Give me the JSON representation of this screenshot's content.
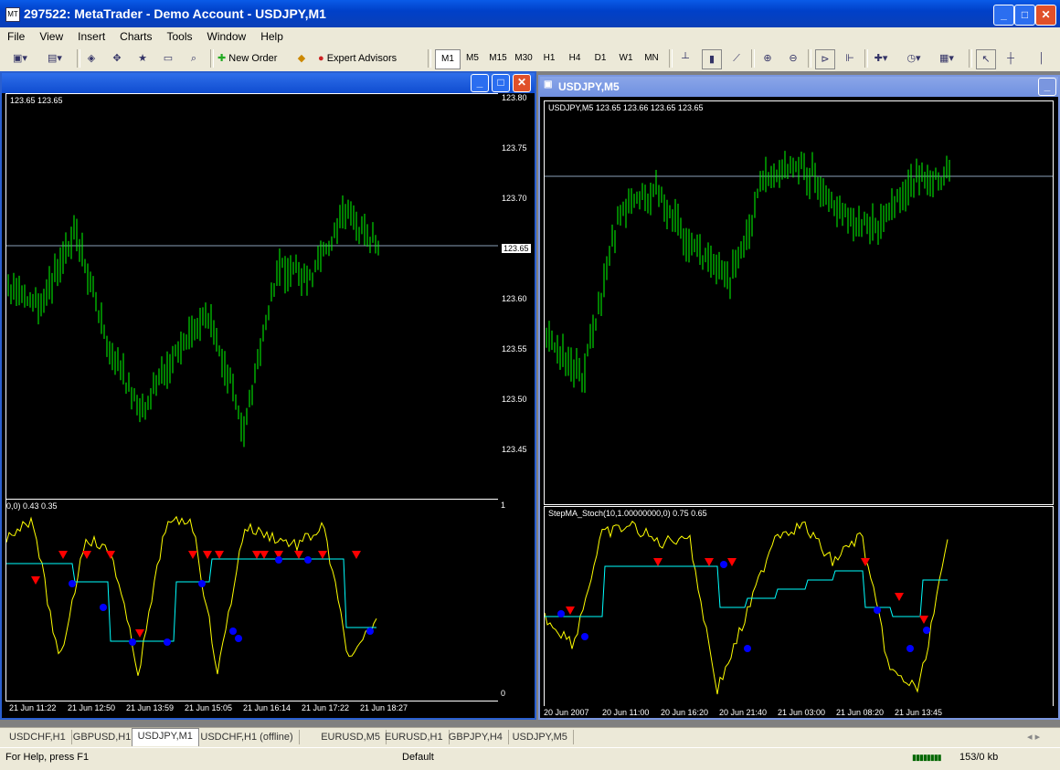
{
  "app": {
    "title": "297522: MetaTrader - Demo Account - USDJPY,M1"
  },
  "menu": [
    "File",
    "View",
    "Insert",
    "Charts",
    "Tools",
    "Window",
    "Help"
  ],
  "toolbar": {
    "new_order": "New Order",
    "expert_advisors": "Expert Advisors",
    "timeframes": [
      "M1",
      "M5",
      "M15",
      "M30",
      "H1",
      "H4",
      "D1",
      "W1",
      "MN"
    ]
  },
  "left_window": {
    "ohlc": "123.65 123.65",
    "price_labels": [
      "123.80",
      "123.75",
      "123.70",
      "123.65",
      "123.60",
      "123.55",
      "123.50",
      "123.45"
    ],
    "current_price": "123.65",
    "indicator_header": "0,0) 0.43 0.35",
    "indicator_scale": [
      "1",
      "0"
    ],
    "time_labels": [
      "21 Jun 11:22",
      "21 Jun 12:50",
      "21 Jun 13:59",
      "21 Jun 15:05",
      "21 Jun 16:14",
      "21 Jun 17:22",
      "21 Jun 18:27"
    ]
  },
  "right_window": {
    "title": "USDJPY,M5",
    "ohlc": "USDJPY,M5  123.65 123.66 123.65 123.65",
    "indicator_header": "StepMA_Stoch(10,1.00000000,0) 0.75 0.65",
    "time_labels": [
      "20 Jun 2007",
      "20 Jun 11:00",
      "20 Jun 16:20",
      "20 Jun 21:40",
      "21 Jun 03:00",
      "21 Jun 08:20",
      "21 Jun 13:45"
    ]
  },
  "tabs": [
    "USDCHF,H1",
    "GBPUSD,H1",
    "USDJPY,M1",
    "USDCHF,H1 (offline)",
    "EURUSD,M5",
    "EURUSD,H1",
    "GBPJPY,H4",
    "USDJPY,M5"
  ],
  "active_tab": "USDJPY,M1",
  "status": {
    "help": "For Help, press F1",
    "profile": "Default",
    "traffic": "153/0 kb"
  },
  "colors": {
    "bars": "#00ff00",
    "stoch": "#ffff00",
    "stepma": "#00ffff",
    "sell_arrow": "#ff0000",
    "buy_arrow": "#0000ff"
  }
}
